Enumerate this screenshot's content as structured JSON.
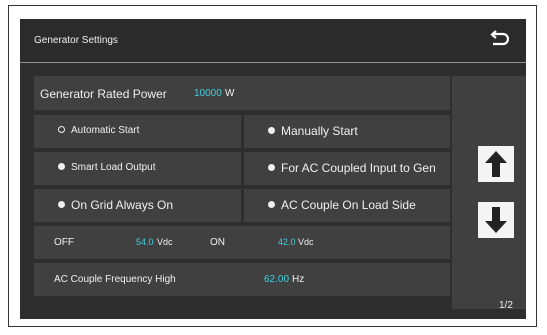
{
  "header": {
    "title": "Generator Settings",
    "back_icon": "back-arrow-icon"
  },
  "rated_power": {
    "label": "Generator Rated Power",
    "value": "10000",
    "unit": "W"
  },
  "options": [
    {
      "label": "Automatic Start",
      "selected": true
    },
    {
      "label": "Manually Start",
      "selected": false
    },
    {
      "label": "Smart Load Output",
      "selected": false
    },
    {
      "label": "For AC Coupled Input to Gen",
      "selected": false
    },
    {
      "label": "On Grid Always On",
      "selected": false
    },
    {
      "label": "AC Couple On Load Side",
      "selected": false
    }
  ],
  "thresholds": {
    "off_label": "OFF",
    "off_value": "54.0",
    "off_unit": "Vdc",
    "on_label": "ON",
    "on_value": "42.0",
    "on_unit": "Vdc"
  },
  "frequency": {
    "label": "AC Couple Frequency High",
    "value": "62.00",
    "unit": "Hz"
  },
  "nav": {
    "up_icon": "arrow-up-icon",
    "down_icon": "arrow-down-icon",
    "page": "1/2"
  },
  "colors": {
    "background": "#2e2e2e",
    "row": "#404040",
    "accent": "#3fd0e0"
  }
}
